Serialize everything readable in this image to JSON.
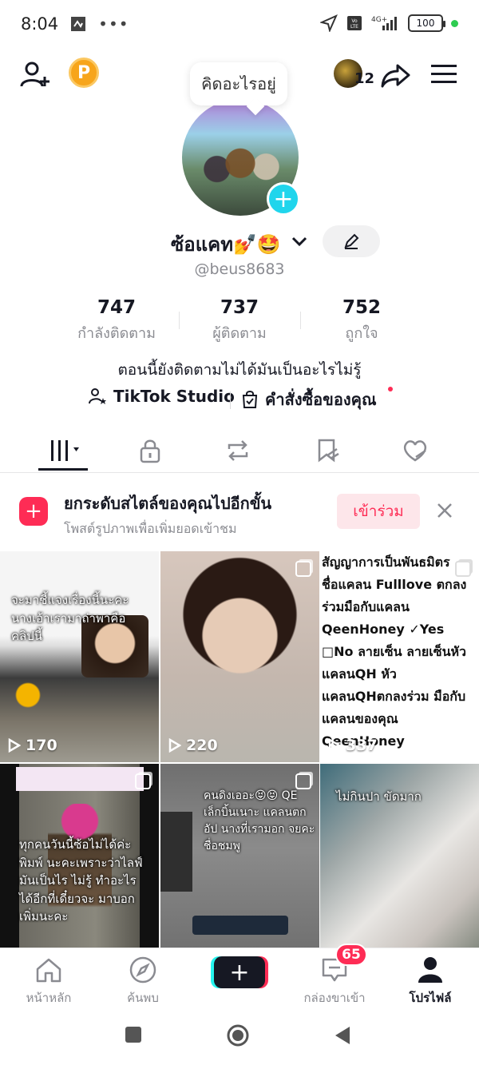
{
  "status_bar": {
    "time": "8:04",
    "battery": "100"
  },
  "header": {
    "thought_bubble": "คิดอะไรอยู่",
    "friends_avatar_count": "12",
    "points_letter": "P"
  },
  "profile": {
    "display_name": "ซ้อแคท💅🤩",
    "username": "@beus8683",
    "bio": "ตอนนี้ยังติดตามไม่ได้มันเป็นอะไรไม่รู้",
    "stats": [
      {
        "value": "747",
        "label": "กำลังติดตาม"
      },
      {
        "value": "737",
        "label": "ผู้ติดตาม"
      },
      {
        "value": "752",
        "label": "ถูกใจ"
      }
    ],
    "links": {
      "studio": "TikTok Studio",
      "orders": "คำสั่งซื้อของคุณ"
    }
  },
  "tabs": [
    {
      "name": "videos-grid",
      "icon": "grid-icon"
    },
    {
      "name": "private",
      "icon": "lock-icon"
    },
    {
      "name": "reposts",
      "icon": "repost-icon"
    },
    {
      "name": "favorites",
      "icon": "bookmark-icon"
    },
    {
      "name": "liked",
      "icon": "heart-icon"
    }
  ],
  "promo": {
    "title": "ยกระดับสไตล์ของคุณไปอีกขั้น",
    "subtitle": "โพสต์รูปภาพเพื่อเพิ่มยอดเข้าชม",
    "join_label": "เข้าร่วม"
  },
  "grid": {
    "cells": [
      {
        "views": "170",
        "caption": "จะมาชี้แจงเรื่องนี้นะคะนางเอ้าเรามาถ่าพาคือคลิปนี้"
      },
      {
        "views": "220",
        "caption": ""
      },
      {
        "views": "337",
        "caption": "สัญญาการเป็นพันธมิตร ชื่อแคลน Fulllove ตกลงร่วมมือกับแคลน QeenHoney ✓Yes □No ลายเซ็น ลายเซ็นหัวแคลนQH หัวแคลนQHตกลงร่วม มือกับแคลนของคุณ QeenHoney"
      },
      {
        "views": "",
        "caption": "ทุกคนวันนี้ซ้อไม่ได้ค่ะพิมพ์ นะคะเพราะว่าไลฟ์มันเป็นไร ไม่รู้ ทำอะไรได้อีกที่เดี๋ยวจะ มาบอกเพิ่มนะคะ"
      },
      {
        "views": "",
        "caption": "คนดิงเออะ😝😝 QE เล็กบิ้นเนาะ แคลนตกอัป นางที่เรามอก จยคะชื่อชมพู"
      },
      {
        "views": "",
        "caption": "ไม่กินปา ขัดมาก"
      }
    ]
  },
  "bottom_nav": {
    "home": "หน้าหลัก",
    "discover": "ค้นพบ",
    "inbox": "กล่องขาเข้า",
    "inbox_badge": "65",
    "profile": "โปรไฟล์"
  }
}
